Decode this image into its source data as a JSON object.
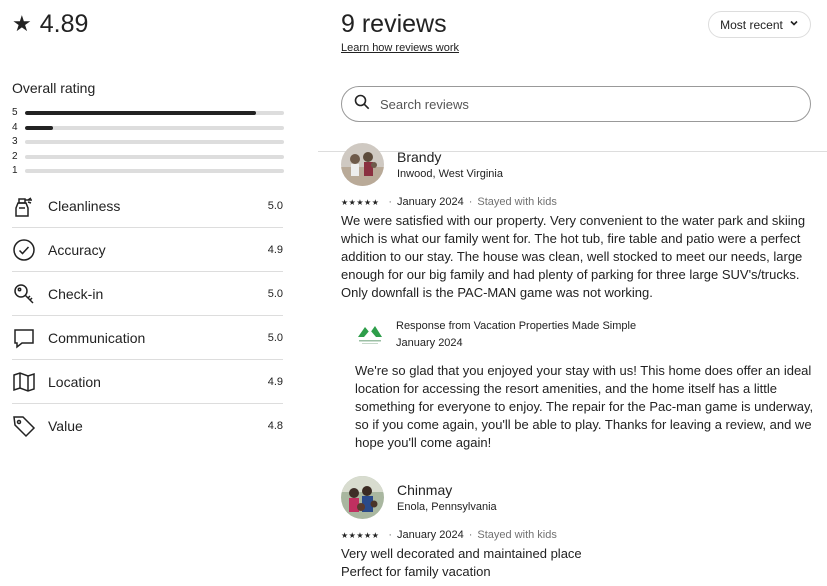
{
  "summary": {
    "score": "4.89",
    "overall_label": "Overall rating",
    "distribution": [
      {
        "stars": "5",
        "fraction": 0.89
      },
      {
        "stars": "4",
        "fraction": 0.11
      },
      {
        "stars": "3",
        "fraction": 0
      },
      {
        "stars": "2",
        "fraction": 0
      },
      {
        "stars": "1",
        "fraction": 0
      }
    ],
    "categories": [
      {
        "icon": "spray-bottle-icon",
        "name": "Cleanliness",
        "value": "5.0"
      },
      {
        "icon": "check-circle-icon",
        "name": "Accuracy",
        "value": "4.9"
      },
      {
        "icon": "key-icon",
        "name": "Check-in",
        "value": "5.0"
      },
      {
        "icon": "chat-bubble-icon",
        "name": "Communication",
        "value": "5.0"
      },
      {
        "icon": "map-icon",
        "name": "Location",
        "value": "4.9"
      },
      {
        "icon": "tag-icon",
        "name": "Value",
        "value": "4.8"
      }
    ]
  },
  "header": {
    "title": "9 reviews",
    "learn_link": "Learn how reviews work",
    "sort_label": "Most recent"
  },
  "search": {
    "placeholder": "Search reviews"
  },
  "reviews": [
    {
      "name": "Brandy",
      "location": "Inwood, West Virginia",
      "stars": "★★★★★",
      "date": "January 2024",
      "stay": "Stayed with kids",
      "text": "We were satisfied with our property. Very convenient to the water park and skiing which is what our family went for. The hot tub, fire table and patio were a perfect addition to our stay. The house was clean, well stocked to meet our needs, large enough for our big family and had plenty of parking for three large SUV's/trucks. Only downfall is the PAC-MAN game was not working.",
      "response": {
        "title": "Response from Vacation Properties Made Simple",
        "date": "January 2024",
        "text": "We're so glad that you enjoyed your stay with us! This home does offer an ideal location for accessing the resort amenities, and the home itself has a little something for everyone to enjoy. The repair for the Pac-man game is underway, so if you come again, you'll be able to play. Thanks for leaving a review, and we hope you'll come again!"
      }
    },
    {
      "name": "Chinmay",
      "location": "Enola, Pennsylvania",
      "stars": "★★★★★",
      "date": "January 2024",
      "stay": "Stayed with kids",
      "text_lines": [
        "Very well decorated and maintained place",
        "Perfect for family vacation"
      ]
    }
  ],
  "colors": {
    "text": "#222222",
    "muted": "#717171",
    "border": "#dddddd",
    "logo_green": "#2e9e4a"
  }
}
